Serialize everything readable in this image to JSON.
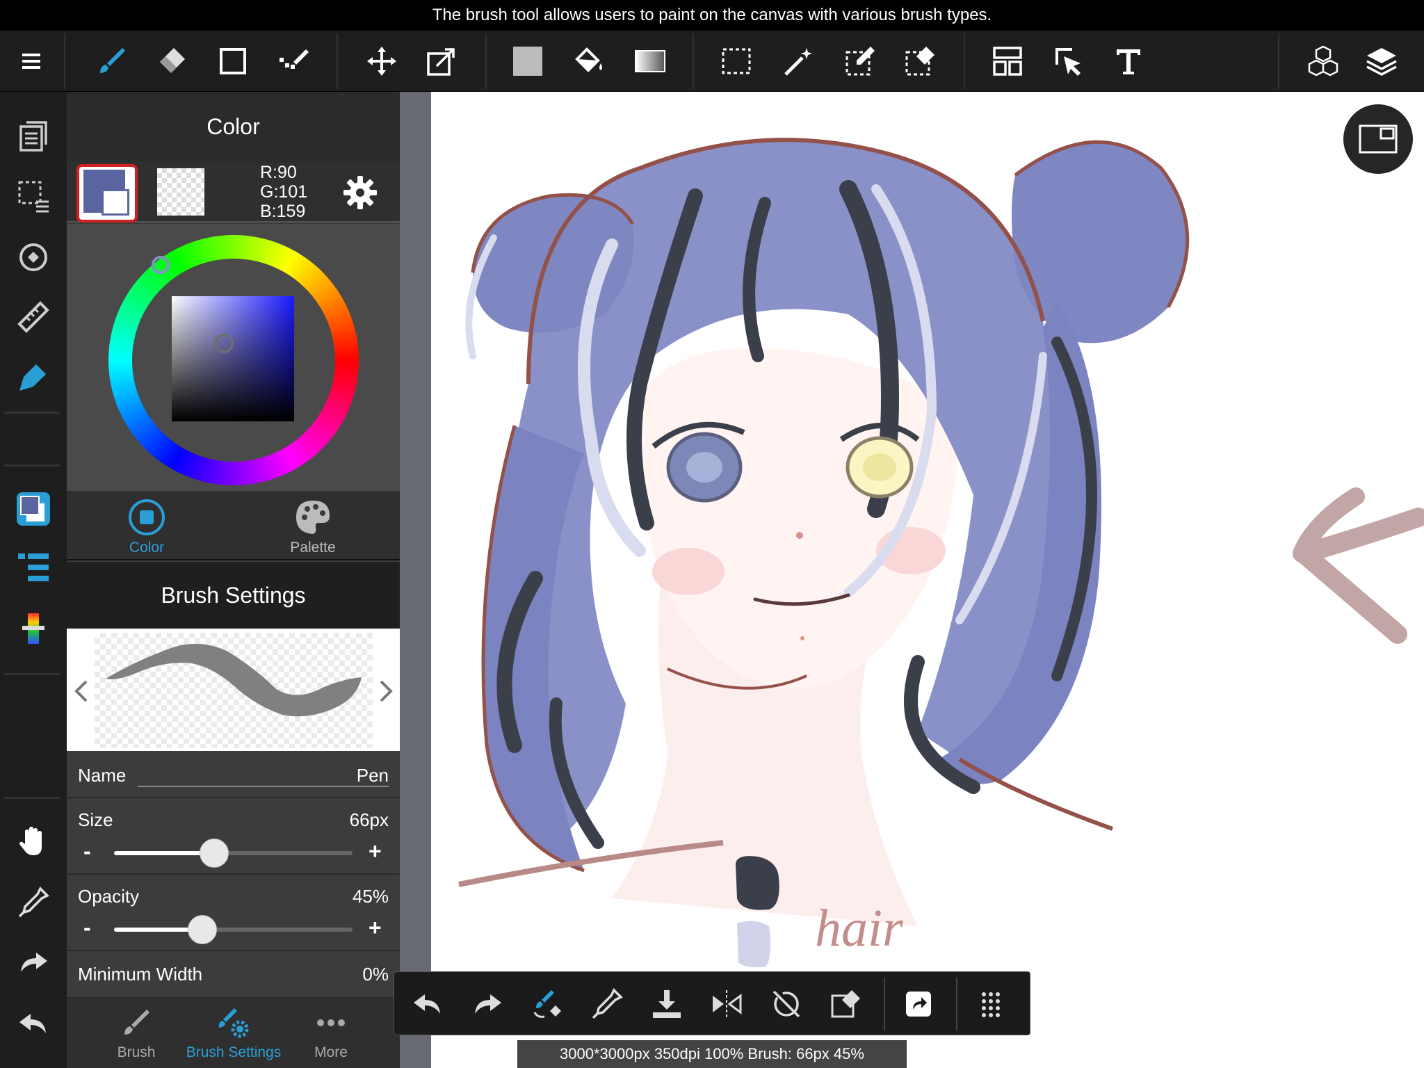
{
  "tooltip": "The brush tool allows users to paint on the canvas with various brush types.",
  "colors": {
    "accent": "#2a9fd6",
    "foreground": "#5a659f",
    "selection_border": "#d4201f"
  },
  "top_toolbar": {
    "icons": [
      "menu-icon",
      "brush-icon",
      "eraser-icon",
      "rectangle-icon",
      "dot-brush-icon",
      "move-icon",
      "transform-icon",
      "fill-color-icon",
      "bucket-icon",
      "gradient-icon",
      "select-rect-icon",
      "magic-wand-icon",
      "select-pen-icon",
      "select-eraser-icon",
      "layout-icon",
      "select-arrow-icon",
      "text-icon",
      "3d-cube-icon",
      "layers-icon"
    ]
  },
  "left_sidebar": {
    "icons": [
      "pages-icon",
      "selection-icon",
      "rotate-icon",
      "ruler-icon",
      "pen-tool-icon",
      "color-icon",
      "layers-list-icon",
      "gradient-strip-icon",
      "hand-icon",
      "eyedropper-icon",
      "redo-icon",
      "undo-icon"
    ]
  },
  "color_panel": {
    "title": "Color",
    "rgb": {
      "r": "R:90",
      "g": "G:101",
      "b": "B:159"
    },
    "tabs": [
      {
        "label": "Color"
      },
      {
        "label": "Palette"
      }
    ]
  },
  "brush_settings": {
    "title": "Brush Settings",
    "name_label": "Name",
    "name_value": "Pen",
    "size_label": "Size",
    "size_value": "66px",
    "size_fraction": 0.42,
    "opacity_label": "Opacity",
    "opacity_value": "45%",
    "opacity_fraction": 0.37,
    "min_width_label": "Minimum Width",
    "min_width_value": "0%",
    "minus": "-",
    "plus": "+"
  },
  "bottom_tabs": [
    {
      "label": "Brush"
    },
    {
      "label": "Brush Settings"
    },
    {
      "label": "More"
    }
  ],
  "canvas": {
    "annotation_text": "hair"
  },
  "status": "3000*3000px 350dpi 100% Brush: 66px 45%"
}
